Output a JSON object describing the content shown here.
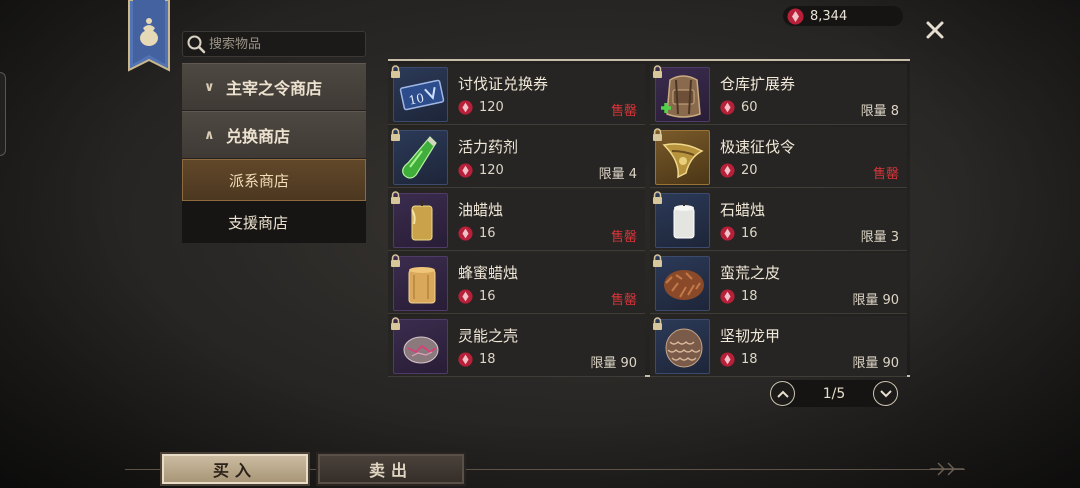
{
  "search": {
    "placeholder": "搜索物品"
  },
  "currency": {
    "amount": "8,344",
    "icon": "ruby-gem-icon",
    "color": "#c2233a"
  },
  "menu": {
    "categories": [
      {
        "label": "主宰之令商店",
        "expanded": false
      },
      {
        "label": "兑换商店",
        "expanded": true
      }
    ],
    "sub_items": [
      {
        "label": "派系商店",
        "active": true
      },
      {
        "label": "支援商店",
        "active": false
      }
    ]
  },
  "items": [
    {
      "name": "讨伐证兑换券",
      "price": "120",
      "status": "售罄",
      "status_type": "soldout",
      "thumb": "voucher-icon",
      "rarity": "blue"
    },
    {
      "name": "仓库扩展券",
      "price": "60",
      "status": "限量 8",
      "status_type": "limit",
      "thumb": "backpack-icon",
      "rarity": "purple"
    },
    {
      "name": "活力药剂",
      "price": "120",
      "status": "限量 4",
      "status_type": "limit",
      "thumb": "potion-icon",
      "rarity": "blue"
    },
    {
      "name": "极速征伐令",
      "price": "20",
      "status": "售罄",
      "status_type": "soldout",
      "thumb": "badge-icon",
      "rarity": "gold"
    },
    {
      "name": "油蜡烛",
      "price": "16",
      "status": "售罄",
      "status_type": "soldout",
      "thumb": "candle-icon",
      "rarity": "purple"
    },
    {
      "name": "石蜡烛",
      "price": "16",
      "status": "限量 3",
      "status_type": "limit",
      "thumb": "white-candle-icon",
      "rarity": "blue"
    },
    {
      "name": "蜂蜜蜡烛",
      "price": "16",
      "status": "售罄",
      "status_type": "soldout",
      "thumb": "honey-candle-icon",
      "rarity": "purple"
    },
    {
      "name": "蛮荒之皮",
      "price": "18",
      "status": "限量 90",
      "status_type": "limit",
      "thumb": "fur-icon",
      "rarity": "blue"
    },
    {
      "name": "灵能之壳",
      "price": "18",
      "status": "限量 90",
      "status_type": "limit",
      "thumb": "shell-icon",
      "rarity": "purple"
    },
    {
      "name": "坚韧龙甲",
      "price": "18",
      "status": "限量 90",
      "status_type": "limit",
      "thumb": "dragon-scale-icon",
      "rarity": "blue"
    }
  ],
  "pager": {
    "text": "1/5"
  },
  "tabs": {
    "buy": "买入",
    "sell": "卖出"
  },
  "colors": {
    "soldout": "#d8353a",
    "accent_gold": "#8d6b3e"
  }
}
